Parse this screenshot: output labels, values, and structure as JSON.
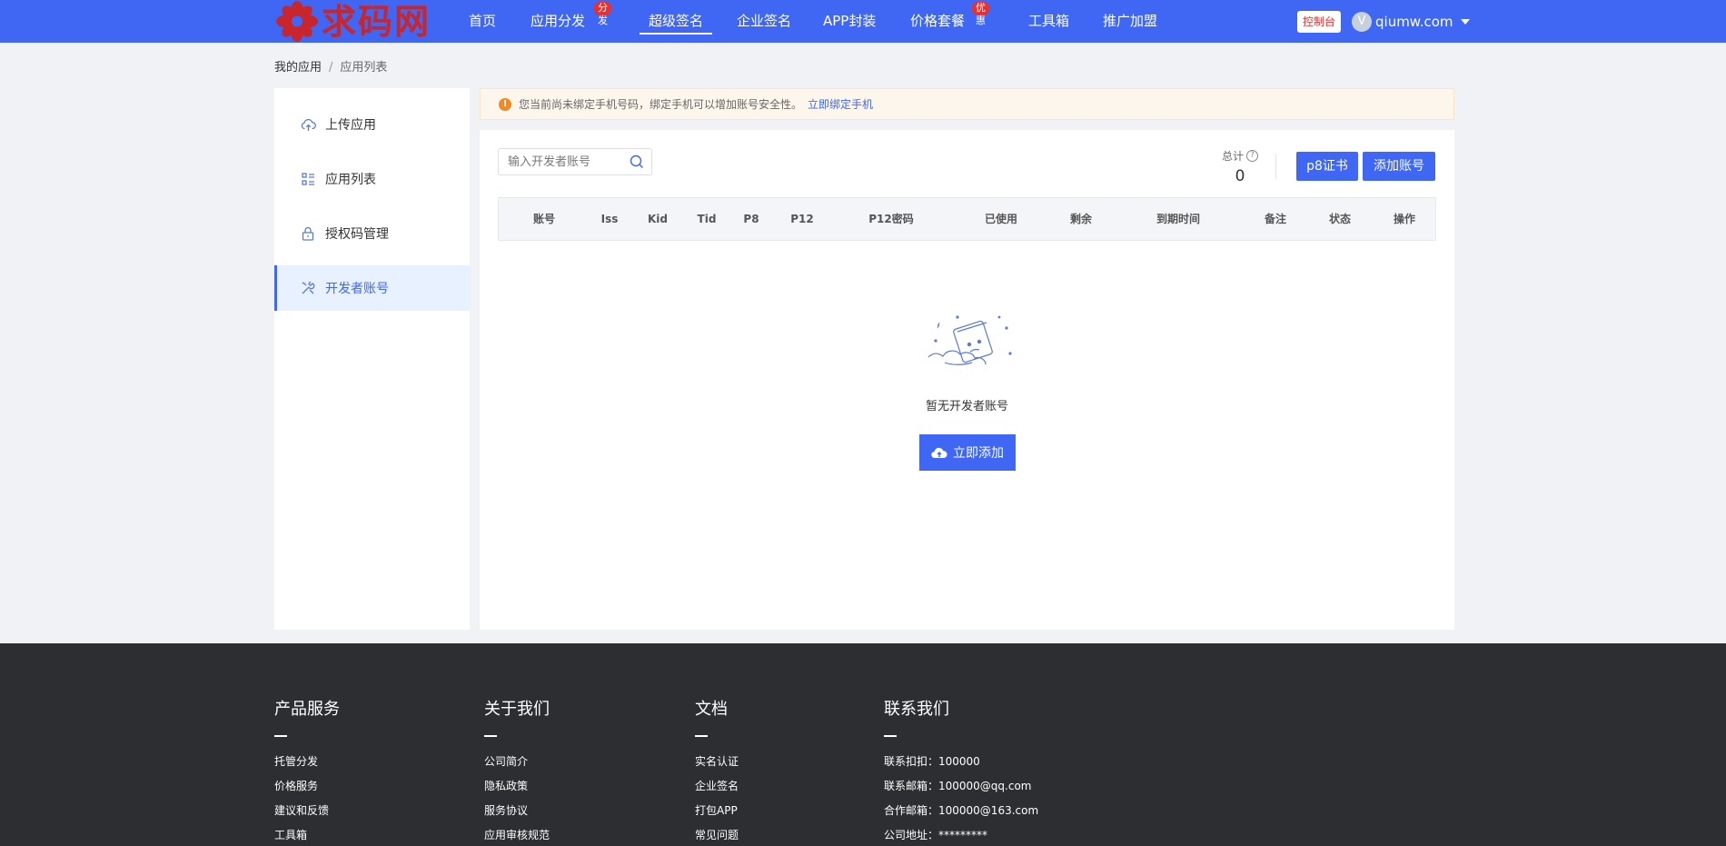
{
  "header": {
    "logo_text": "求码网",
    "nav": [
      {
        "label": "首页",
        "badge": ""
      },
      {
        "label": "应用分发",
        "badge": "分发"
      },
      {
        "label": "超级签名",
        "badge": ""
      },
      {
        "label": "企业签名",
        "badge": ""
      },
      {
        "label": "APP封装",
        "badge": ""
      },
      {
        "label": "价格套餐",
        "badge": "优惠"
      },
      {
        "label": "工具箱",
        "badge": ""
      },
      {
        "label": "推广加盟",
        "badge": ""
      }
    ],
    "active_nav": "超级签名",
    "console_label": "控制台",
    "avatar_letter": "V",
    "username": "qiumw.com"
  },
  "breadcrumb": {
    "parent": "我的应用",
    "separator": "/",
    "current": "应用列表"
  },
  "sidebar": {
    "items": [
      {
        "label": "上传应用",
        "icon": "cloud-upload-icon"
      },
      {
        "label": "应用列表",
        "icon": "list-icon"
      },
      {
        "label": "授权码管理",
        "icon": "lock-icon"
      },
      {
        "label": "开发者账号",
        "icon": "tools-icon"
      }
    ],
    "active": "开发者账号"
  },
  "alert": {
    "icon": "!",
    "text": "您当前尚未绑定手机号码，绑定手机可以增加账号安全性。",
    "link": "立即绑定手机"
  },
  "toolbar": {
    "search_placeholder": "输入开发者账号",
    "total_label": "总计",
    "help_symbol": "?",
    "total_value": "0",
    "p8_button": "p8证书",
    "add_button": "添加账号"
  },
  "table": {
    "columns": [
      "账号",
      "Iss",
      "Kid",
      "Tid",
      "P8",
      "P12",
      "P12密码",
      "已使用",
      "剩余",
      "到期时间",
      "备注",
      "状态",
      "操作"
    ],
    "empty_text": "暂无开发者账号",
    "empty_action": "立即添加"
  },
  "footer": {
    "columns": [
      {
        "title": "产品服务",
        "links": [
          "托管分发",
          "价格服务",
          "建议和反馈",
          "工具箱"
        ]
      },
      {
        "title": "关于我们",
        "links": [
          "公司简介",
          "隐私政策",
          "服务协议",
          "应用审核规范"
        ]
      },
      {
        "title": "文档",
        "links": [
          "实名认证",
          "企业签名",
          "打包APP",
          "常见问题"
        ]
      },
      {
        "title": "联系我们",
        "links": [
          "联系扣扣：100000",
          "联系邮箱：100000@qq.com",
          "合作邮箱：100000@163.com",
          "公司地址：*********"
        ]
      }
    ]
  },
  "colors": {
    "primary": "#3f67f3",
    "badge": "#e83030",
    "footer_bg": "#2d2e31",
    "alert_bg": "#fdf6ec"
  }
}
